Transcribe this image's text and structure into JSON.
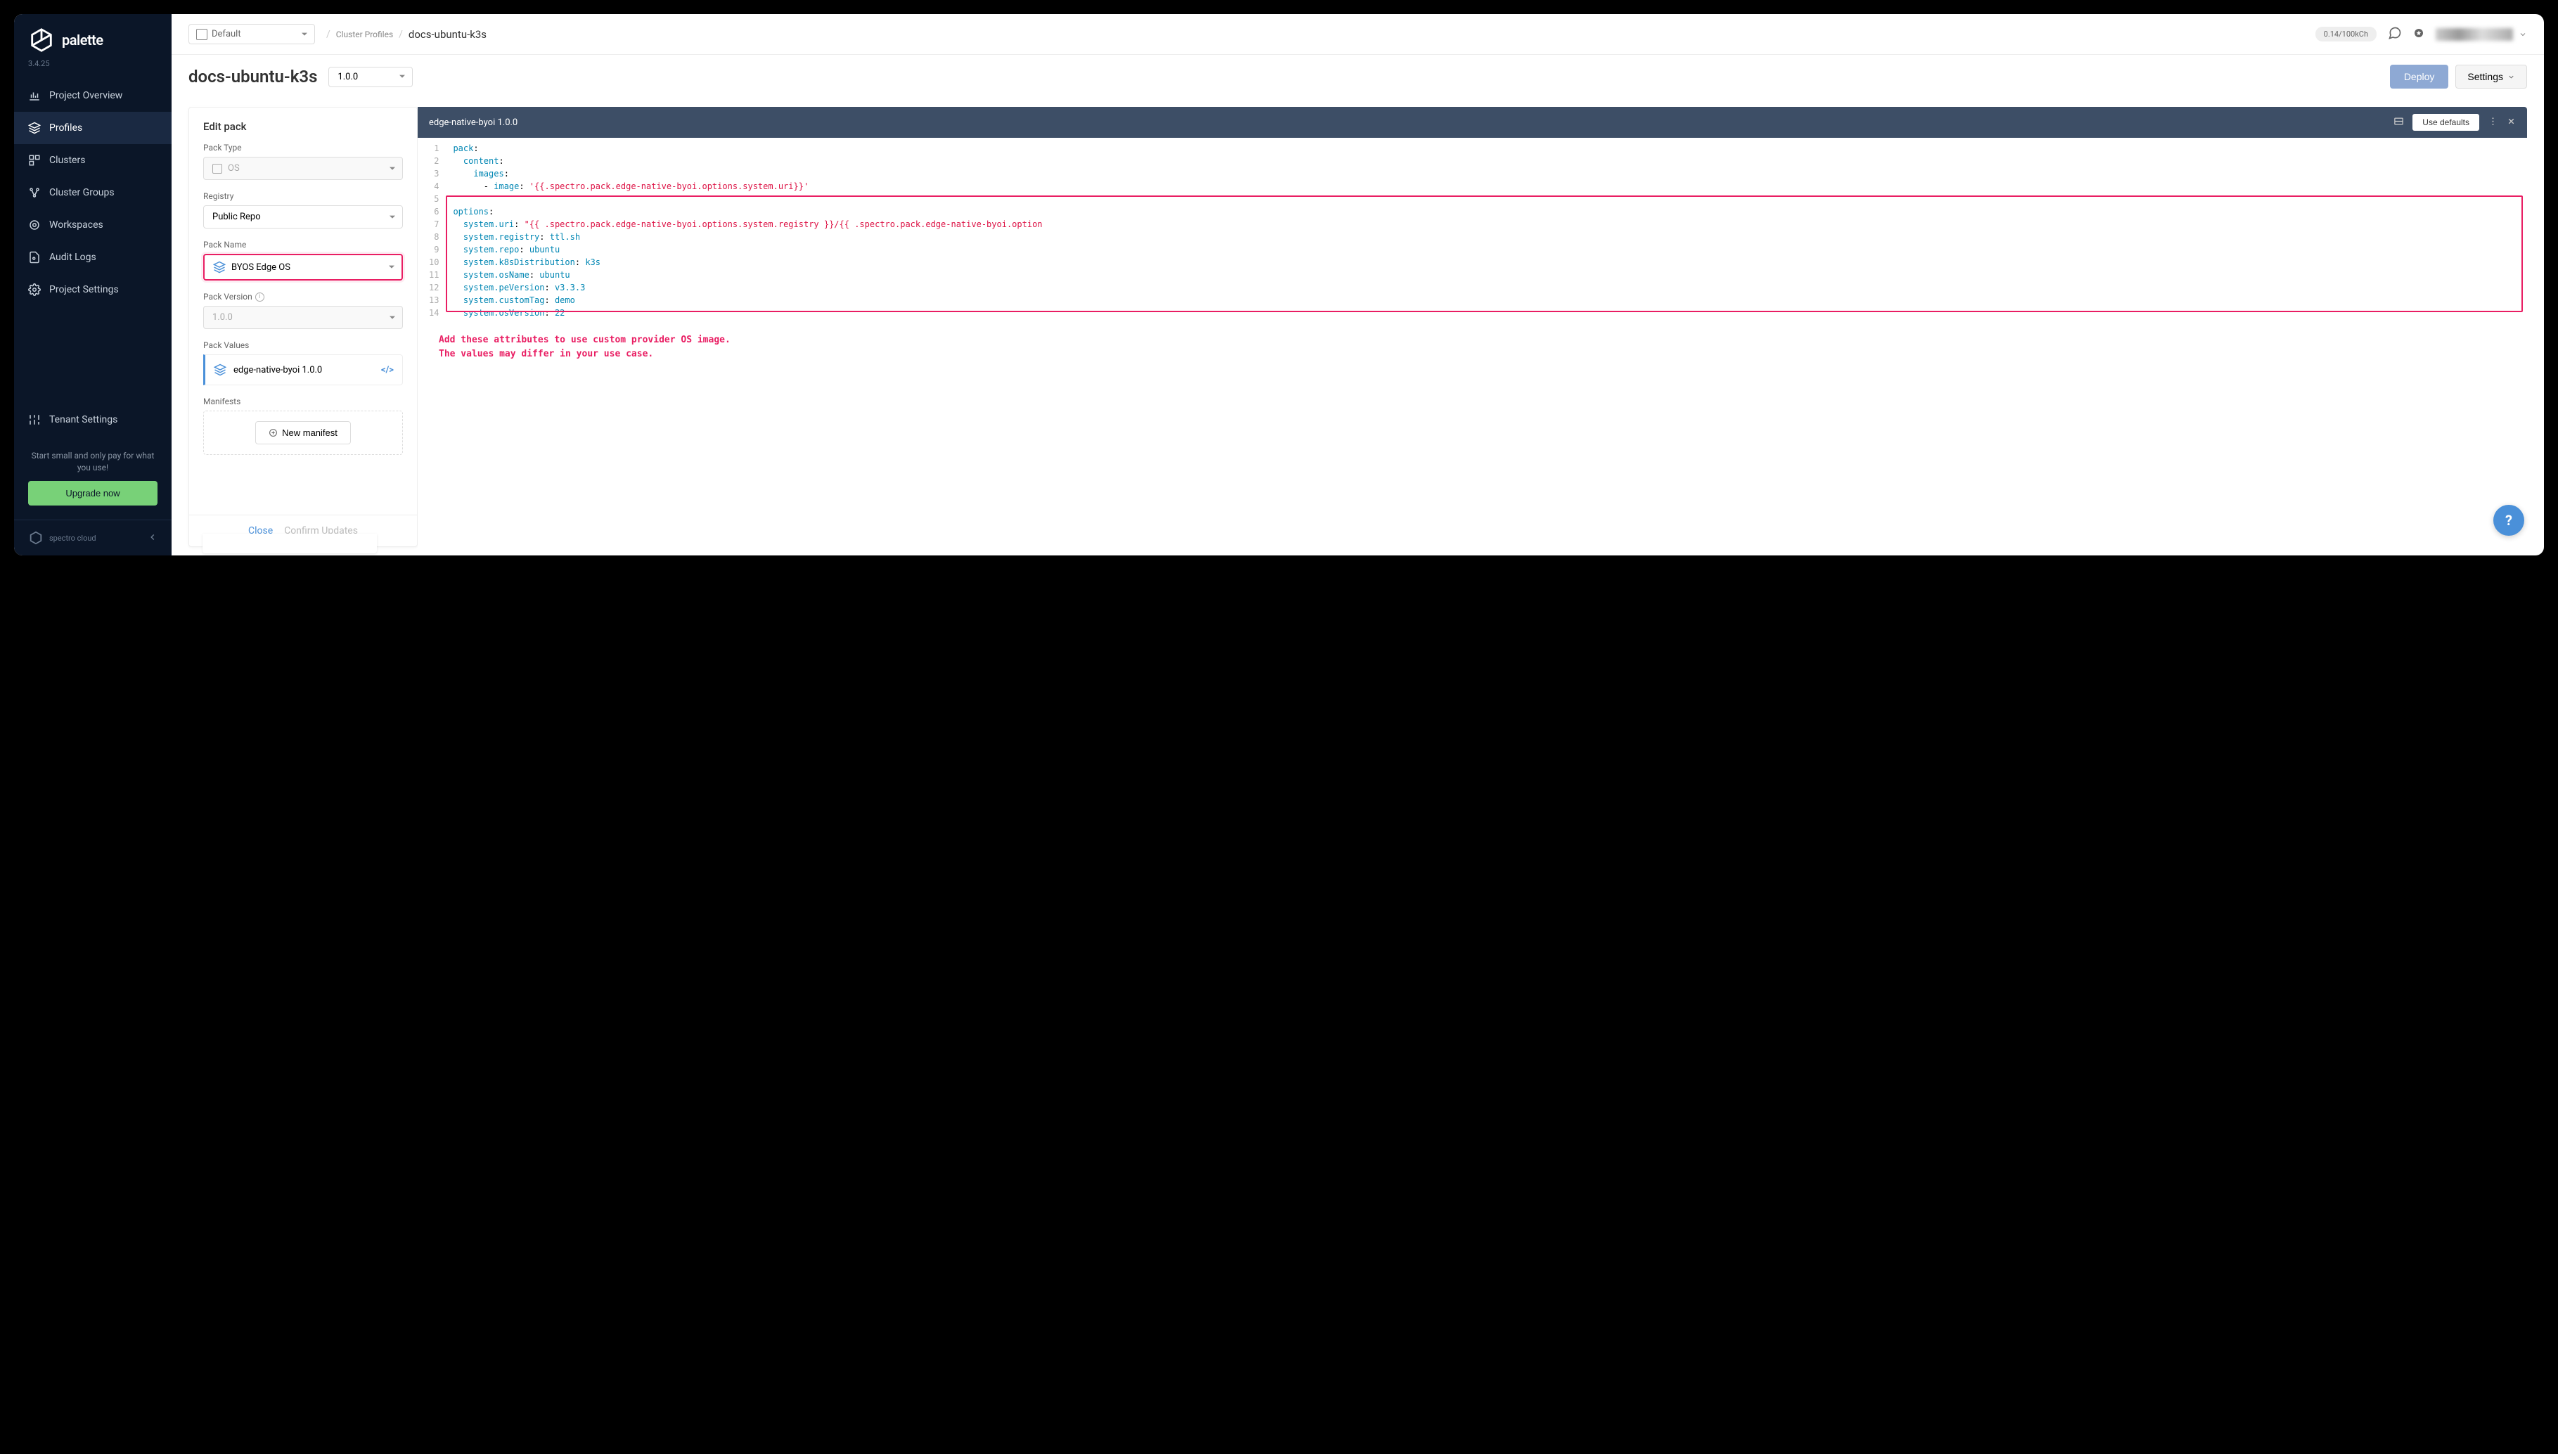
{
  "brand": {
    "name": "palette",
    "version": "3.4.25",
    "company": "spectro cloud"
  },
  "sidebar": {
    "items": [
      {
        "label": "Project Overview",
        "icon": "chart"
      },
      {
        "label": "Profiles",
        "icon": "layers",
        "active": true
      },
      {
        "label": "Clusters",
        "icon": "grid"
      },
      {
        "label": "Cluster Groups",
        "icon": "share"
      },
      {
        "label": "Workspaces",
        "icon": "target"
      },
      {
        "label": "Audit Logs",
        "icon": "file"
      },
      {
        "label": "Project Settings",
        "icon": "gear"
      }
    ],
    "tenant_label": "Tenant Settings",
    "promo": "Start small and only pay for what you use!",
    "upgrade_label": "Upgrade now"
  },
  "topbar": {
    "scope": "Default",
    "breadcrumb_link": "Cluster Profiles",
    "breadcrumb_current": "docs-ubuntu-k3s",
    "credits": "0.14/100kCh"
  },
  "page": {
    "title": "docs-ubuntu-k3s",
    "version": "1.0.0",
    "deploy_label": "Deploy",
    "settings_label": "Settings"
  },
  "edit_panel": {
    "title": "Edit pack",
    "fields": {
      "pack_type": {
        "label": "Pack Type",
        "value": "OS"
      },
      "registry": {
        "label": "Registry",
        "value": "Public Repo"
      },
      "pack_name": {
        "label": "Pack Name",
        "value": "BYOS Edge OS"
      },
      "pack_version": {
        "label": "Pack Version",
        "value": "1.0.0"
      }
    },
    "pack_values": {
      "label": "Pack Values",
      "item": "edge-native-byoi 1.0.0"
    },
    "manifests": {
      "label": "Manifests",
      "new_label": "New manifest"
    },
    "close_label": "Close",
    "confirm_label": "Confirm Updates"
  },
  "code_panel": {
    "title": "edge-native-byoi 1.0.0",
    "use_defaults_label": "Use defaults",
    "lines": [
      [
        [
          "k",
          "pack"
        ],
        [
          "p",
          ":"
        ]
      ],
      [
        [
          "p",
          "  "
        ],
        [
          "k",
          "content"
        ],
        [
          "p",
          ":"
        ]
      ],
      [
        [
          "p",
          "    "
        ],
        [
          "k",
          "images"
        ],
        [
          "p",
          ":"
        ]
      ],
      [
        [
          "p",
          "      - "
        ],
        [
          "k",
          "image"
        ],
        [
          "p",
          ": "
        ],
        [
          "s",
          "'{{.spectro.pack.edge-native-byoi.options.system.uri}}'"
        ]
      ],
      [],
      [
        [
          "k",
          "options"
        ],
        [
          "p",
          ":"
        ]
      ],
      [
        [
          "p",
          "  "
        ],
        [
          "k",
          "system.uri"
        ],
        [
          "p",
          ": "
        ],
        [
          "s",
          "\"{{ .spectro.pack.edge-native-byoi.options.system.registry }}/{{ .spectro.pack.edge-native-byoi.option"
        ]
      ],
      [
        [
          "p",
          "  "
        ],
        [
          "k",
          "system.registry"
        ],
        [
          "p",
          ": "
        ],
        [
          "v",
          "ttl.sh"
        ]
      ],
      [
        [
          "p",
          "  "
        ],
        [
          "k",
          "system.repo"
        ],
        [
          "p",
          ": "
        ],
        [
          "v",
          "ubuntu"
        ]
      ],
      [
        [
          "p",
          "  "
        ],
        [
          "k",
          "system.k8sDistribution"
        ],
        [
          "p",
          ": "
        ],
        [
          "v",
          "k3s"
        ]
      ],
      [
        [
          "p",
          "  "
        ],
        [
          "k",
          "system.osName"
        ],
        [
          "p",
          ": "
        ],
        [
          "v",
          "ubuntu"
        ]
      ],
      [
        [
          "p",
          "  "
        ],
        [
          "k",
          "system.peVersion"
        ],
        [
          "p",
          ": "
        ],
        [
          "v",
          "v3.3.3"
        ]
      ],
      [
        [
          "p",
          "  "
        ],
        [
          "k",
          "system.customTag"
        ],
        [
          "p",
          ": "
        ],
        [
          "v",
          "demo"
        ]
      ],
      [
        [
          "p",
          "  "
        ],
        [
          "k",
          "system.osVersion"
        ],
        [
          "p",
          ": "
        ],
        [
          "v",
          "22"
        ]
      ]
    ],
    "annotation_line1": "Add these attributes to use custom provider OS image.",
    "annotation_line2": "The values may differ in your use case."
  }
}
